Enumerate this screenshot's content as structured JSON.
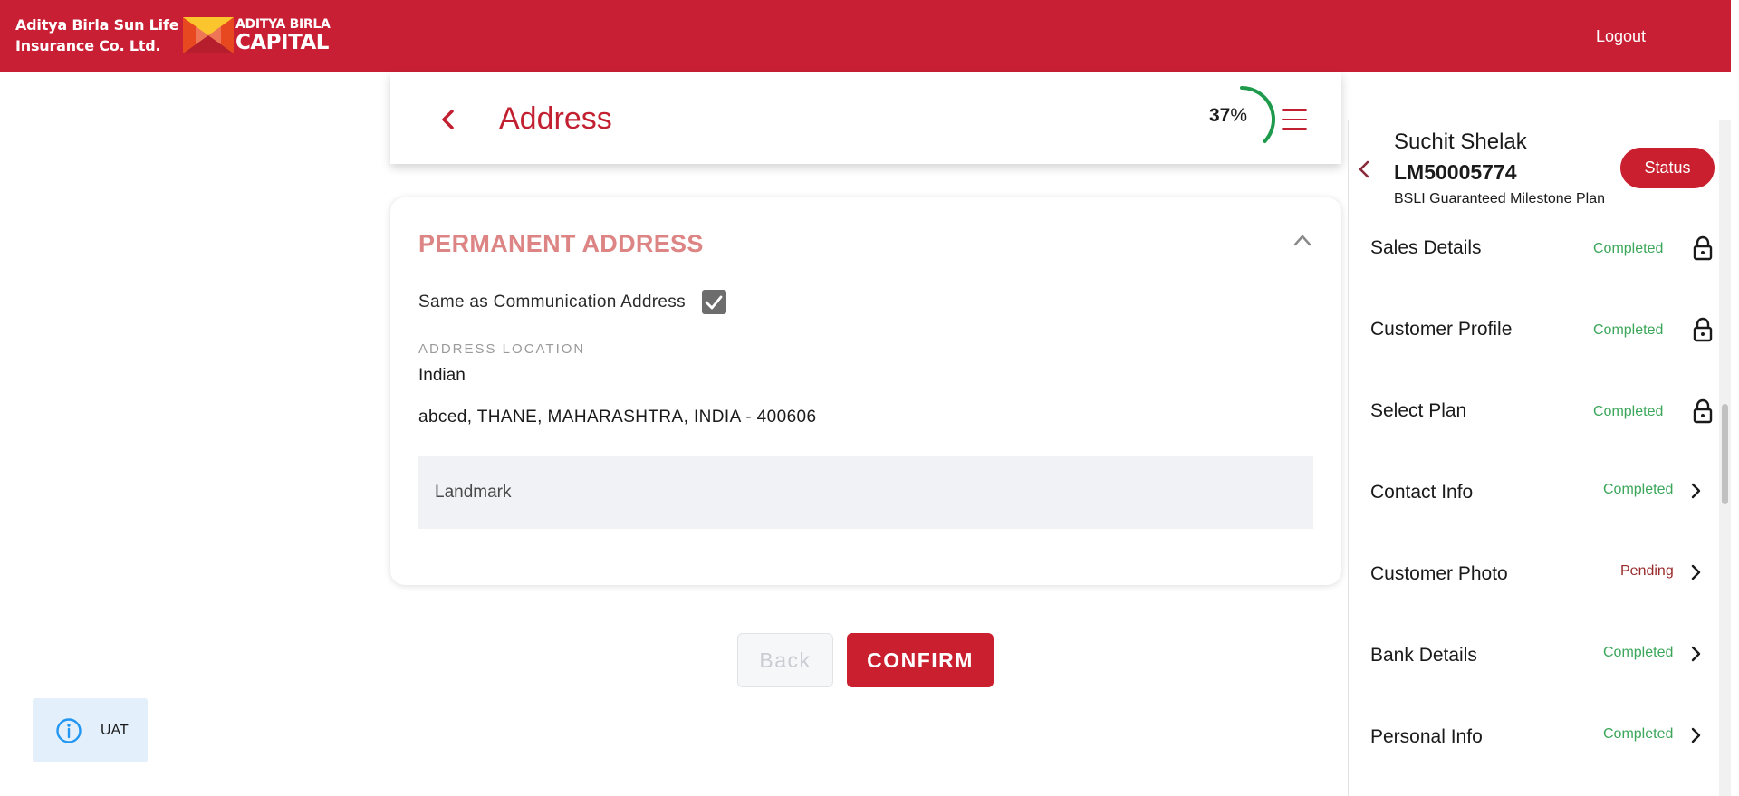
{
  "header": {
    "company_line1": "Aditya Birla Sun Life",
    "company_line2": "Insurance Co. Ltd.",
    "logo_top": "ADITYA BIRLA",
    "logo_bottom": "CAPITAL",
    "logout_label": "Logout",
    "brand_color": "#c91f34"
  },
  "page": {
    "title": "Address",
    "progress_value": "37",
    "progress_unit": "%",
    "progress_fraction": 0.37
  },
  "permanent_address": {
    "title": "PERMANENT ADDRESS",
    "same_as_label": "Same as Communication Address",
    "same_as_checked": true,
    "location_label": "ADDRESS LOCATION",
    "location_value": "Indian",
    "address_line": "abced, THANE, MAHARASHTRA, INDIA - 400606",
    "landmark_placeholder": "Landmark",
    "landmark_value": ""
  },
  "actions": {
    "back_label": "Back",
    "confirm_label": "CONFIRM"
  },
  "env_badge": {
    "label": "UAT",
    "icon": "info-icon"
  },
  "sidebar": {
    "customer_name": "Suchit Shelak",
    "application_id": "LM50005774",
    "plan_name": "BSLI Guaranteed Milestone Plan",
    "status_label": "Status",
    "items": [
      {
        "label": "Sales Details",
        "status": "Completed",
        "icon": "lock-icon"
      },
      {
        "label": "Customer Profile",
        "status": "Completed",
        "icon": "lock-icon"
      },
      {
        "label": "Select Plan",
        "status": "Completed",
        "icon": "lock-icon"
      },
      {
        "label": "Contact Info",
        "status": "Completed",
        "icon": "chevron-right-icon"
      },
      {
        "label": "Customer Photo",
        "status": "Pending",
        "icon": "chevron-right-icon"
      },
      {
        "label": "Bank Details",
        "status": "Completed",
        "icon": "chevron-right-icon"
      },
      {
        "label": "Personal Info",
        "status": "Completed",
        "icon": "chevron-right-icon"
      }
    ]
  }
}
